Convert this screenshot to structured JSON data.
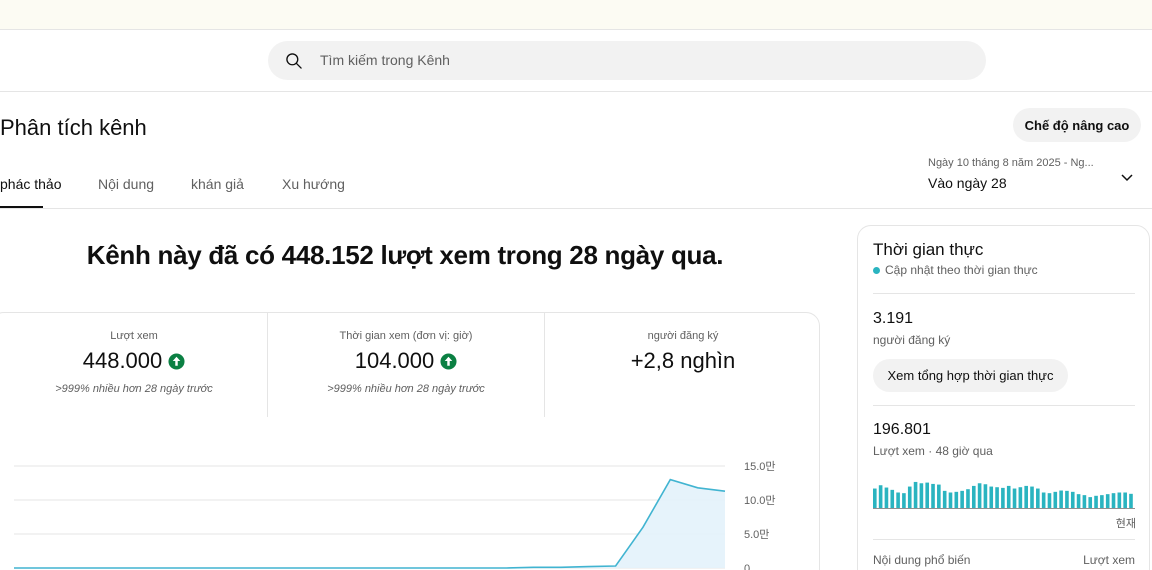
{
  "search": {
    "placeholder": "Tìm kiếm trong Kênh"
  },
  "page": {
    "title": "Phân tích kênh"
  },
  "header": {
    "advanced_mode_label": "Chế độ nâng cao"
  },
  "tabs": [
    {
      "label": "phác thảo",
      "active": true
    },
    {
      "label": "Nội dung",
      "active": false
    },
    {
      "label": "khán giả",
      "active": false
    },
    {
      "label": "Xu hướng",
      "active": false
    }
  ],
  "date": {
    "range": "Ngày 10 tháng 8 năm 2025 - Ng...",
    "period": "Vào ngày 28"
  },
  "headline": "Kênh này đã có 448.152 lượt xem trong 28 ngày qua.",
  "metrics": [
    {
      "label": "Lượt xem",
      "value": "448.000",
      "trend": "up",
      "comparison": ">999% nhiều hơn 28 ngày trước"
    },
    {
      "label": "Thời gian xem (đơn vị: giờ)",
      "value": "104.000",
      "trend": "up",
      "comparison": ">999% nhiều hơn 28 ngày trước"
    },
    {
      "label": "người đăng ký",
      "value": "+2,8 nghìn",
      "trend": null,
      "comparison": ""
    }
  ],
  "colors": {
    "accent": "#2ab4c0",
    "up": "#0b8043",
    "line": "#41b4d1",
    "area": "#e3f2fb"
  },
  "chart_data": {
    "type": "area",
    "y_ticks": [
      "15.0만",
      "10.0만",
      "5.0만",
      "0"
    ],
    "ylim": [
      0,
      150000
    ],
    "values": [
      0,
      0,
      0,
      0,
      0,
      0,
      0,
      0,
      0,
      0,
      0,
      0,
      0,
      0,
      0,
      0,
      0,
      0,
      0,
      1000,
      1000,
      2000,
      3000,
      60000,
      130000,
      118000,
      113000
    ],
    "grid": true
  },
  "realtime": {
    "title": "Thời gian thực",
    "live_label": "Cập nhật theo thời gian thực",
    "subscribers": "3.191",
    "subscribers_label": "người đăng ký",
    "summary_button": "Xem tổng hợp thời gian thực",
    "views": "196.801",
    "views_label": "Lượt xem · 48 giờ qua",
    "now_label": "현재",
    "top_content_label": "Nội dung phổ biến",
    "top_content_column": "Lượt xem",
    "bars": [
      0.62,
      0.72,
      0.65,
      0.58,
      0.5,
      0.48,
      0.68,
      0.82,
      0.78,
      0.8,
      0.76,
      0.74,
      0.55,
      0.5,
      0.52,
      0.55,
      0.6,
      0.7,
      0.78,
      0.75,
      0.68,
      0.66,
      0.64,
      0.7,
      0.62,
      0.66,
      0.7,
      0.68,
      0.62,
      0.5,
      0.48,
      0.52,
      0.56,
      0.55,
      0.52,
      0.45,
      0.42,
      0.36,
      0.4,
      0.42,
      0.45,
      0.48,
      0.5,
      0.5,
      0.46
    ]
  }
}
